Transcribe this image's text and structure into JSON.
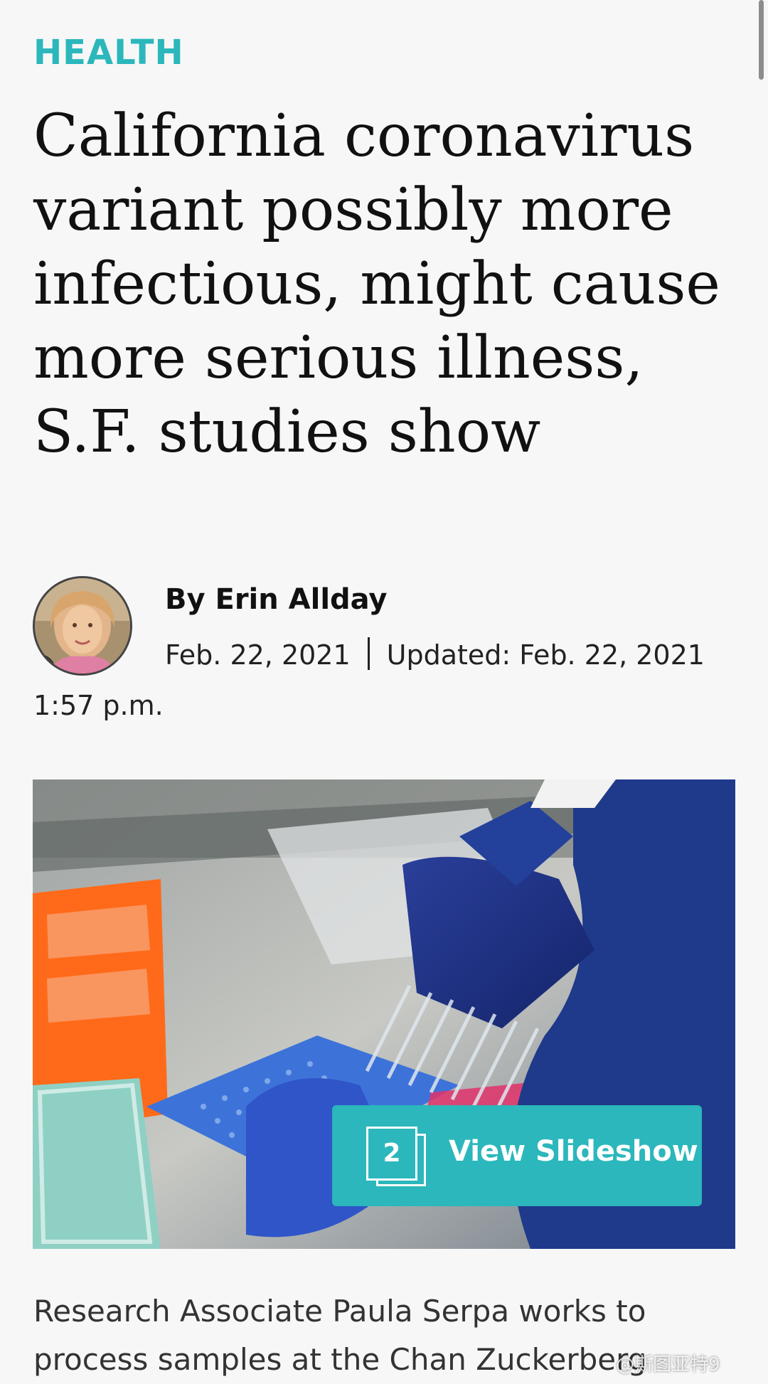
{
  "article": {
    "section": "HEALTH",
    "headline": "California coronavirus variant possibly more infectious, might cause more serious illness, S.F. studies show",
    "byline": "By Erin Allday",
    "published": "Feb. 22, 2021",
    "updated": "Updated: Feb. 22, 2021",
    "updated_time": "1:57 p.m.",
    "caption": "Research Associate Paula Serpa works to process samples at the Chan Zuckerberg"
  },
  "slideshow": {
    "count": "2",
    "label": "View Slideshow"
  },
  "watermark": "@斯图亚特9",
  "colors": {
    "accent": "#2bb7bb",
    "background": "#f7f7f7",
    "text": "#111111"
  },
  "icons": {
    "slideshow": "stacked-photos-icon"
  }
}
